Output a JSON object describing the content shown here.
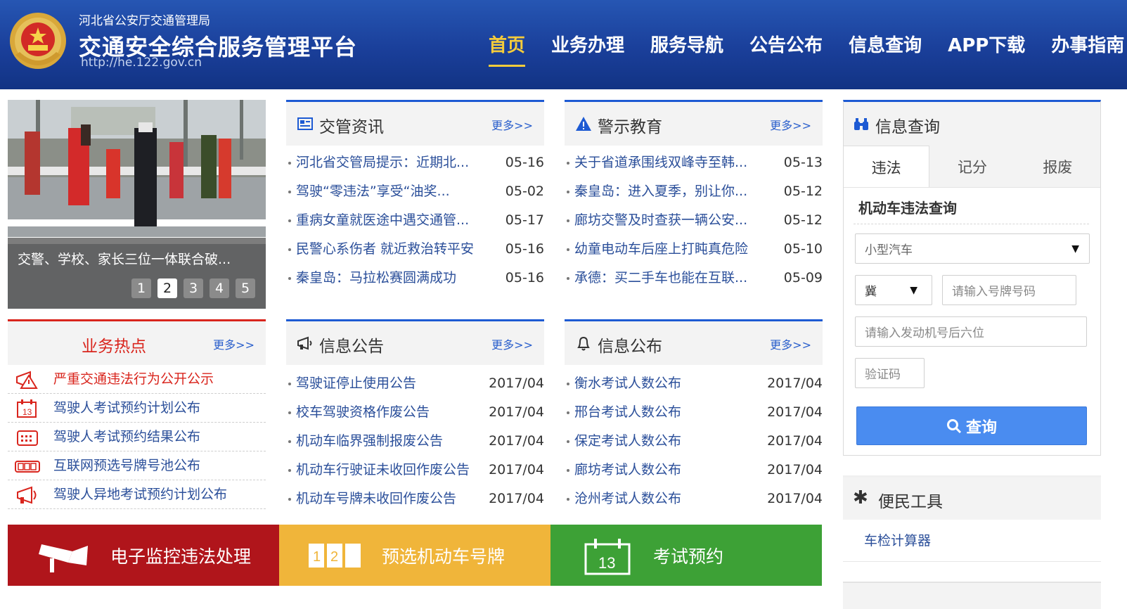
{
  "header": {
    "org": "河北省公安厅交通管理局",
    "title": "交通安全综合服务管理平台",
    "url": "http://he.122.gov.cn",
    "nav": [
      "首页",
      "业务办理",
      "服务导航",
      "公告公布",
      "信息查询",
      "APP下载",
      "办事指南"
    ],
    "active_nav": "首页"
  },
  "carousel": {
    "caption": "交警、学校、家长三位一体联合破...",
    "pages": [
      "1",
      "2",
      "3",
      "4",
      "5"
    ],
    "active_page": "2"
  },
  "news": {
    "title": "交管资讯",
    "more": "更多>>",
    "items": [
      {
        "text": "河北省交管局提示：近期北...",
        "date": "05-16"
      },
      {
        "text": "驾驶“零违法”享受“油奖...",
        "date": "05-02"
      },
      {
        "text": "重病女童就医途中遇交通管...",
        "date": "05-17"
      },
      {
        "text": "民警心系伤者 就近救治转平安",
        "date": "05-16"
      },
      {
        "text": "秦皇岛：马拉松赛圆满成功",
        "date": "05-16"
      }
    ]
  },
  "warning": {
    "title": "警示教育",
    "more": "更多>>",
    "items": [
      {
        "text": "关于省道承围线双峰寺至韩...",
        "date": "05-13"
      },
      {
        "text": "秦皇岛：进入夏季，别让你...",
        "date": "05-12"
      },
      {
        "text": "廊坊交警及时查获一辆公安...",
        "date": "05-12"
      },
      {
        "text": "幼童电动车后座上打盹真危险",
        "date": "05-10"
      },
      {
        "text": "承德：买二手车也能在互联...",
        "date": "05-09"
      }
    ]
  },
  "hot": {
    "title": "业务热点",
    "more": "更多>>",
    "items": [
      {
        "text": "严重交通违法行为公开公示",
        "icon": "megaphone-warning-icon"
      },
      {
        "text": "驾驶人考试预约计划公布",
        "icon": "calendar-13-icon"
      },
      {
        "text": "驾驶人考试预约结果公布",
        "icon": "calendar-grid-icon"
      },
      {
        "text": "互联网预选号牌号池公布",
        "icon": "license-plate-icon"
      },
      {
        "text": "驾驶人异地考试预约计划公布",
        "icon": "megaphone-icon"
      }
    ]
  },
  "notice": {
    "title": "信息公告",
    "more": "更多>>",
    "items": [
      {
        "text": "驾驶证停止使用公告",
        "date": "2017/04"
      },
      {
        "text": "校车驾驶资格作废公告",
        "date": "2017/04"
      },
      {
        "text": "机动车临界强制报废公告",
        "date": "2017/04"
      },
      {
        "text": "机动车行驶证未收回作废公告",
        "date": "2017/04"
      },
      {
        "text": "机动车号牌未收回作废公告",
        "date": "2017/04"
      }
    ]
  },
  "publish": {
    "title": "信息公布",
    "more": "更多>>",
    "items": [
      {
        "text": "衡水考试人数公布",
        "date": "2017/04"
      },
      {
        "text": "邢台考试人数公布",
        "date": "2017/04"
      },
      {
        "text": "保定考试人数公布",
        "date": "2017/04"
      },
      {
        "text": "廊坊考试人数公布",
        "date": "2017/04"
      },
      {
        "text": "沧州考试人数公布",
        "date": "2017/04"
      }
    ]
  },
  "banners": [
    {
      "label": "电子监控违法处理",
      "color": "#b0151b"
    },
    {
      "label": "预选机动车号牌",
      "color": "#f0b53a"
    },
    {
      "label": "考试预约",
      "color": "#3da136"
    }
  ],
  "query": {
    "title": "信息查询",
    "tabs": [
      "违法",
      "记分",
      "报废"
    ],
    "active_tab": "违法",
    "form_title": "机动车违法查询",
    "vehicle_type": "小型汽车",
    "province": "冀",
    "plate_placeholder": "请输入号牌号码",
    "engine_placeholder": "请输入发动机号后六位",
    "captcha_placeholder": "验证码",
    "button": "查询"
  },
  "tools": {
    "title": "便民工具",
    "items": [
      "车检计算器"
    ]
  },
  "colors": {
    "header_blue": "#1a3f9a",
    "active_yellow": "#f5cc3b",
    "link_blue": "#2b4f9a",
    "hot_red": "#d9251d",
    "button_blue": "#4a8cf0"
  }
}
